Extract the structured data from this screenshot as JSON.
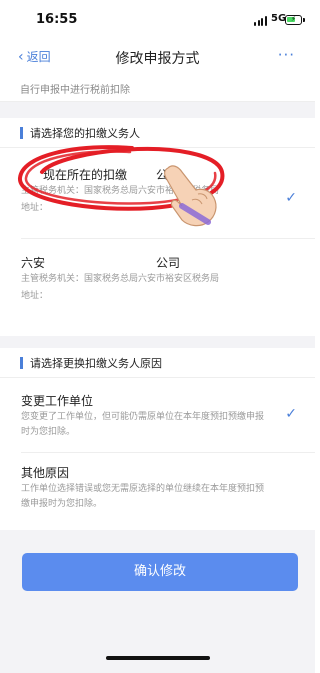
{
  "status_bar": {
    "time": "16:55",
    "network": "5G"
  },
  "nav": {
    "back_label": "返回",
    "title": "修改申报方式",
    "more_label": "···"
  },
  "note": "自行申报中进行税前扣除",
  "section1": {
    "heading": "请选择您的扣缴义务人",
    "items": [
      {
        "name": "现在所在的扣缴",
        "name_suffix": "公司",
        "tax_office": "主管税务机关：国家税务总局六安市裕安区税务局",
        "address": "地址：",
        "selected": true
      },
      {
        "name": "六安",
        "name_suffix": "公司",
        "tax_office": "主管税务机关：国家税务总局六安市裕安区税务局",
        "address": "地址：",
        "selected": false
      }
    ]
  },
  "section2": {
    "heading": "请选择更换扣缴义务人原因",
    "items": [
      {
        "title": "变更工作单位",
        "desc": "您变更了工作单位，但可能仍需原单位在本年度预扣预缴申报时为您扣除。",
        "selected": true
      },
      {
        "title": "其他原因",
        "desc": "工作单位选择错误或您无需原选择的单位继续在本年度预扣预缴申报时为您扣除。",
        "selected": false
      }
    ]
  },
  "confirm_label": "确认修改",
  "colors": {
    "accent": "#4a7fd9",
    "button": "#5b8cee",
    "annotation": "#e41e26"
  }
}
